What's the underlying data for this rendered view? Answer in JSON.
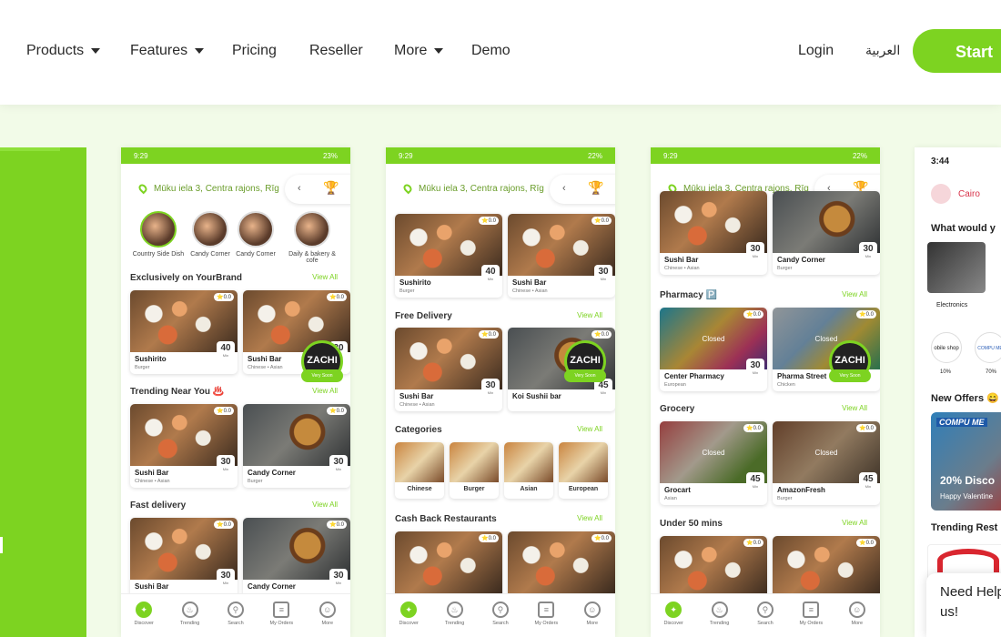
{
  "nav": {
    "items": [
      {
        "label": "Products",
        "dropdown": true
      },
      {
        "label": "Features",
        "dropdown": true
      },
      {
        "label": "Pricing",
        "dropdown": false
      },
      {
        "label": "Reseller",
        "dropdown": false
      },
      {
        "label": "More",
        "dropdown": true
      },
      {
        "label": "Demo",
        "dropdown": false
      }
    ],
    "login": "Login",
    "lang": "العربية",
    "start": "Start"
  },
  "colors": {
    "brand": "#7dd321",
    "background": "#f2fbe8"
  },
  "phones": [
    {
      "time": "9:29",
      "battery": "23%",
      "location": "Mūku iela 3, Centra rajons, Rīg",
      "categories": [
        "Country Side Dish",
        "Candy Corner",
        "Candy Corner",
        "Daily & bakery & cofe"
      ],
      "sections": [
        {
          "title": "Exclusively on YourBrand",
          "view_all": "View All"
        },
        {
          "title": "Trending Near You ♨️",
          "view_all": "View All"
        },
        {
          "title": "Fast delivery",
          "view_all": "View All"
        }
      ],
      "cards": [
        {
          "name": "Sushirito",
          "sub": "Burger",
          "rating": "0.0",
          "mins": "40"
        },
        {
          "name": "Sushi Bar",
          "sub": "Chinese • Asian",
          "rating": "0.0",
          "mins": "30"
        },
        {
          "name": "Sushi Bar",
          "sub": "Chinese • Asian",
          "rating": "0.0",
          "mins": "30"
        },
        {
          "name": "Candy Corner",
          "sub": "Burger",
          "rating": "0.0",
          "mins": "30"
        },
        {
          "name": "Sushi Bar",
          "sub": "",
          "rating": "0.0",
          "mins": "30"
        },
        {
          "name": "Candy Corner",
          "sub": "",
          "rating": "0.0",
          "mins": "30"
        }
      ],
      "badge": {
        "logo": "ZACHI",
        "soon": "Very Soon"
      }
    },
    {
      "time": "9:29",
      "battery": "22%",
      "location": "Mūku iela 3, Centra rajons, Rīg",
      "sections": [
        {
          "title": "Free Delivery",
          "view_all": "View All"
        },
        {
          "title": "Categories",
          "view_all": "View All"
        },
        {
          "title": "Cash Back Restaurants",
          "view_all": "View All"
        }
      ],
      "cards": [
        {
          "name": "Sushirito",
          "sub": "Burger",
          "rating": "0.0",
          "mins": "40"
        },
        {
          "name": "Sushi Bar",
          "sub": "Chinese • Asian",
          "rating": "0.0",
          "mins": "30"
        },
        {
          "name": "Sushi Bar",
          "sub": "Chinese • Asian",
          "rating": "0.0",
          "mins": "30"
        },
        {
          "name": "Koi Sushii bar",
          "sub": "",
          "rating": "0.0",
          "mins": "45"
        }
      ],
      "food_categories": [
        "Chinese",
        "Burger",
        "Asian",
        "European"
      ],
      "badge": {
        "logo": "ZACHI",
        "soon": "Very Soon"
      }
    },
    {
      "time": "9:29",
      "battery": "22%",
      "location": "Mūku iela 3, Centra rajons, Rīg",
      "sections": [
        {
          "title": "Pharmacy 🅿️",
          "view_all": "View All"
        },
        {
          "title": "Grocery",
          "view_all": "View All"
        },
        {
          "title": "Under 50 mins",
          "view_all": "View All"
        }
      ],
      "cards": [
        {
          "name": "Sushi Bar",
          "sub": "Chinese • Asian",
          "rating": "",
          "mins": "30"
        },
        {
          "name": "Candy Corner",
          "sub": "Burger",
          "rating": "",
          "mins": "30"
        },
        {
          "name": "Center Pharmacy",
          "sub": "European",
          "rating": "0.0",
          "mins": "30",
          "closed": "Closed"
        },
        {
          "name": "Pharma Street",
          "sub": "Chicken",
          "rating": "0.0",
          "mins": "",
          "closed": "Closed"
        },
        {
          "name": "Grocart",
          "sub": "Asian",
          "rating": "0.0",
          "mins": "45",
          "closed": "Closed"
        },
        {
          "name": "AmazonFresh",
          "sub": "Burger",
          "rating": "0.0",
          "mins": "45",
          "closed": "Closed"
        }
      ],
      "badge": {
        "logo": "ZACHI",
        "soon": "Very Soon"
      }
    }
  ],
  "bottom_nav": [
    "Discover",
    "Trending",
    "Search",
    "My Orders",
    "More"
  ],
  "phone4": {
    "time": "3:44",
    "city": "Cairo",
    "heading": "What would y",
    "cat1": "Electronics",
    "shop1": "obile shop",
    "shop1_pct": "10%",
    "shop2": "COMPU ME",
    "shop2_pct": "70%",
    "offers": "New Offers 😄",
    "offer_brand": "COMPU ME",
    "offer_title": "20% Disco",
    "offer_sub": "Happy Valentine",
    "trending": "Trending Rest"
  },
  "chat": {
    "text": "Need Help us!"
  }
}
